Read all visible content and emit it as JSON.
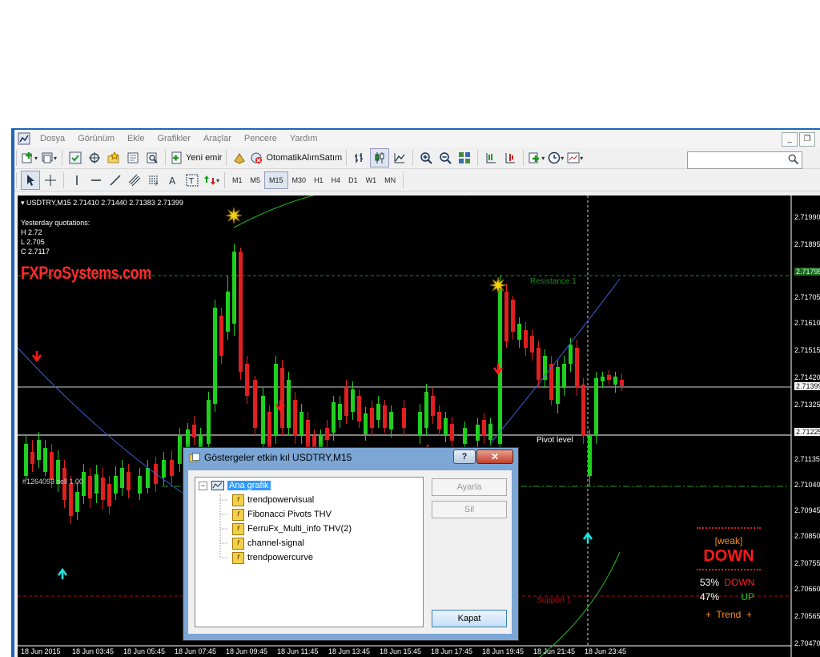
{
  "menu": [
    "Dosya",
    "Görünüm",
    "Ekle",
    "Grafikler",
    "Araçlar",
    "Pencere",
    "Yardım"
  ],
  "toolbar": {
    "new_order": "Yeni emir",
    "auto_trading": "OtomatikAlımSatım"
  },
  "timeframes": [
    "M1",
    "M5",
    "M15",
    "M30",
    "H1",
    "H4",
    "D1",
    "W1",
    "MN"
  ],
  "active_timeframe": "M15",
  "chart": {
    "header": "USDTRY,M15  2.71410 2.71440 2.71383 2.71399",
    "yesterday_title": "Yesterday quotations:",
    "yesterday_h": "H 2.72",
    "yesterday_l": "L 2.705",
    "yesterday_c": "C 2.7117",
    "brand": "FXProSystems.com",
    "resistance_label": "Resistance 1",
    "pivot_label": "Pivot level",
    "support_label": "Support 1",
    "order_label": "#1264093 sell 1.00",
    "price_labels": [
      "2.71990",
      "2.71895",
      "2.71795",
      "2.71705",
      "2.71610",
      "2.71515",
      "2.71420",
      "2.71399",
      "2.71325",
      "2.71225",
      "2.71135",
      "2.71040",
      "2.70945",
      "2.70850",
      "2.70755",
      "2.70660",
      "2.70565",
      "2.70470"
    ],
    "time_labels": [
      "18 Jun 2015",
      "18 Jun 03:45",
      "18 Jun 05:45",
      "18 Jun 07:45",
      "18 Jun 09:45",
      "18 Jun 11:45",
      "18 Jun 13:45",
      "18 Jun 15:45",
      "18 Jun 17:45",
      "18 Jun 19:45",
      "18 Jun 21:45",
      "18 Jun 23:45"
    ],
    "colors": {
      "bull": "#1fd01f",
      "bear": "#e02020",
      "resistance": "#1f8a1f",
      "support": "#b01010"
    }
  },
  "trend_panel": {
    "weak": "[weak]",
    "direction": "DOWN",
    "down_pct": "53%",
    "down_label": "DOWN",
    "up_pct": "47%",
    "up_label": "UP",
    "trend": "+  Trend  +"
  },
  "dialog": {
    "title": "Göstergeler etkin kıl USDTRY,M15",
    "root": "Ana grafik",
    "indicators": [
      "trendpowervisual",
      "Fibonacci Pivots THV",
      "FerruFx_Multi_info THV(2)",
      "channel-signal",
      "trendpowercurve"
    ],
    "btn_edit": "Ayarla",
    "btn_delete": "Sil",
    "btn_close": "Kapat"
  }
}
